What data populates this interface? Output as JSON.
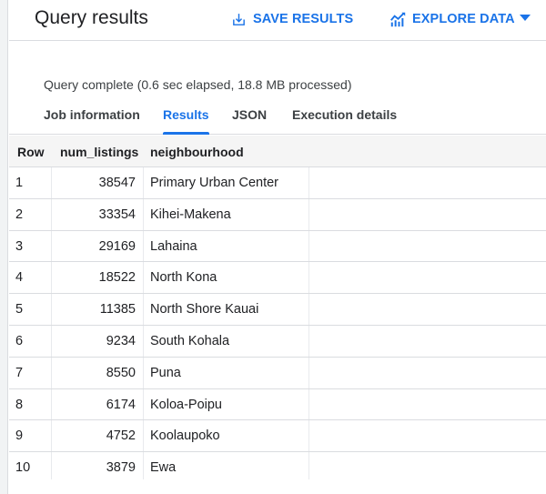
{
  "header": {
    "title": "Query results",
    "save_results_label": "SAVE RESULTS",
    "save_results_icon": "download-icon",
    "explore_data_label": "EXPLORE DATA",
    "explore_data_icon": "chart-icon",
    "dropdown_icon": "caret-down-icon",
    "accent_color": "#1a73e8"
  },
  "status": {
    "text": "Query complete (0.6 sec elapsed, 18.8 MB processed)"
  },
  "tabs": [
    {
      "label": "Job information",
      "active": false
    },
    {
      "label": "Results",
      "active": true
    },
    {
      "label": "JSON",
      "active": false
    },
    {
      "label": "Execution details",
      "active": false
    }
  ],
  "table": {
    "columns": [
      "Row",
      "num_listings",
      "neighbourhood"
    ],
    "rows": [
      {
        "row": "1",
        "num_listings": "38547",
        "neighbourhood": "Primary Urban Center"
      },
      {
        "row": "2",
        "num_listings": "33354",
        "neighbourhood": "Kihei-Makena"
      },
      {
        "row": "3",
        "num_listings": "29169",
        "neighbourhood": "Lahaina"
      },
      {
        "row": "4",
        "num_listings": "18522",
        "neighbourhood": "North Kona"
      },
      {
        "row": "5",
        "num_listings": "11385",
        "neighbourhood": "North Shore Kauai"
      },
      {
        "row": "6",
        "num_listings": "9234",
        "neighbourhood": "South Kohala"
      },
      {
        "row": "7",
        "num_listings": "8550",
        "neighbourhood": "Puna"
      },
      {
        "row": "8",
        "num_listings": "6174",
        "neighbourhood": "Koloa-Poipu"
      },
      {
        "row": "9",
        "num_listings": "4752",
        "neighbourhood": "Koolaupoko"
      },
      {
        "row": "10",
        "num_listings": "3879",
        "neighbourhood": "Ewa"
      }
    ]
  }
}
